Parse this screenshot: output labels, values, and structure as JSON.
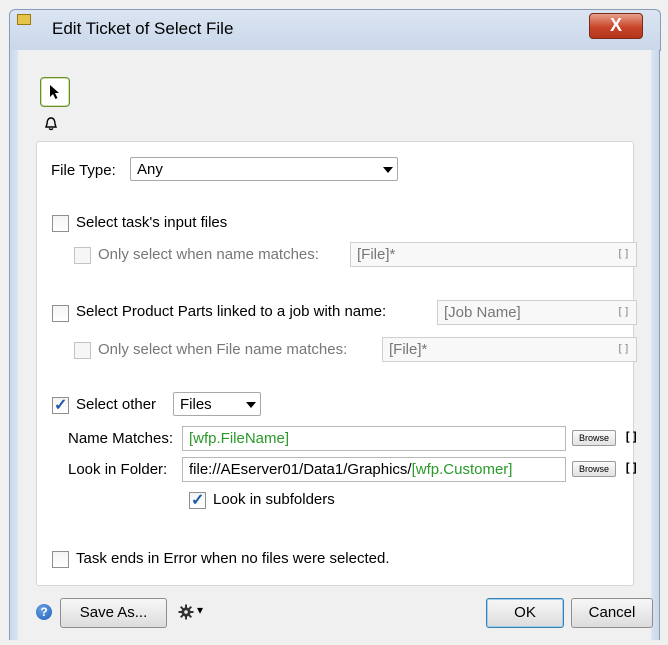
{
  "window": {
    "title": "Edit Ticket of Select File",
    "close_glyph": "X"
  },
  "toolbar": {
    "select_tool": "pointer-icon",
    "bell": "bell-icon"
  },
  "file_type": {
    "label": "File Type:",
    "value": "Any"
  },
  "task_input": {
    "label": "Select task's input files",
    "checked": false,
    "sub_label": "Only select when name matches:",
    "sub_value": "[File]*",
    "sub_brackets": "[]"
  },
  "product_parts": {
    "label": "Select Product Parts linked to a job with name:",
    "value": "[Job Name]",
    "brackets": "[]",
    "sub_label": "Only select when File name matches:",
    "sub_value": "[File]*",
    "sub_brackets": "[]"
  },
  "select_other": {
    "label": "Select other",
    "checked": true,
    "type_value": "Files",
    "name_matches_label": "Name Matches:",
    "name_matches_value": "[wfp.FileName]",
    "look_in_label": "Look in Folder:",
    "look_in_prefix": "file://AEserver01/Data1/Graphics/",
    "look_in_var": "[wfp.Customer]",
    "browse_label": "Browse",
    "brackets": "[]",
    "subfolders_label": "Look in subfolders",
    "subfolders_checked": true
  },
  "task_ends": {
    "label": "Task ends in Error when no files were selected.",
    "checked": false
  },
  "footer": {
    "help_glyph": "?",
    "save_as": "Save As...",
    "gear_caret": "▾",
    "ok": "OK",
    "cancel": "Cancel"
  },
  "colors": {
    "accent_green": "#2a9a2a",
    "check_blue": "#1e5aa8",
    "close_red": "#c7452a"
  }
}
